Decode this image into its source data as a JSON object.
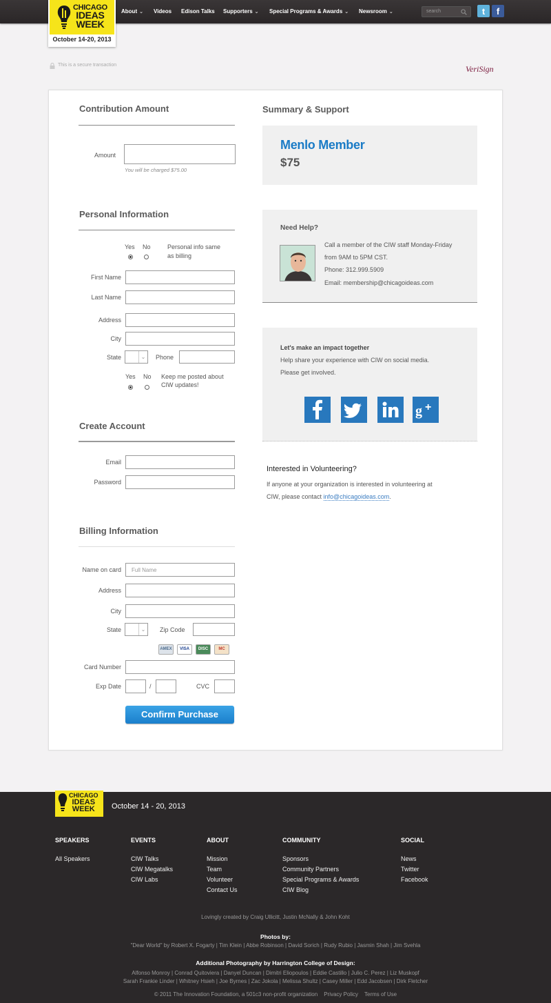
{
  "header": {
    "logo": {
      "line1": "CHICAGO",
      "line2": "IDEAS",
      "line3": "WEEK",
      "date": "October 14-20, 2013"
    },
    "nav": [
      {
        "label": "About",
        "dropdown": true
      },
      {
        "label": "Videos",
        "dropdown": false
      },
      {
        "label": "Edison Talks",
        "dropdown": false
      },
      {
        "label": "Supporters",
        "dropdown": true
      },
      {
        "label": "Special Programs & Awards",
        "dropdown": true
      },
      {
        "label": "Newsroom",
        "dropdown": true
      }
    ],
    "search_placeholder": "search",
    "social": {
      "twitter": "t",
      "facebook": "f"
    }
  },
  "secure": {
    "text": "This is a secure transaction",
    "verisign": "VeriSign"
  },
  "form": {
    "contribution": {
      "title": "Contribution Amount",
      "amount_label": "Amount",
      "amount_value": "",
      "hint": "You will be charged $75.00"
    },
    "personal": {
      "title": "Personal Information",
      "same_yes": "Yes",
      "same_no": "No",
      "same_text_1": "Personal info same",
      "same_text_2": "as billing",
      "first_name": "First Name",
      "last_name": "Last Name",
      "address": "Address",
      "city": "City",
      "state": "State",
      "phone": "Phone",
      "post_yes": "Yes",
      "post_no": "No",
      "post_text_1": "Keep me posted about",
      "post_text_2": "CIW updates!"
    },
    "account": {
      "title": "Create Account",
      "email": "Email",
      "password": "Password"
    },
    "billing": {
      "title": "Billing Information",
      "name_on_card": "Name on card",
      "name_placeholder": "Full Name",
      "address": "Address",
      "city": "City",
      "state": "State",
      "zip": "Zip Code",
      "cards": [
        "AMEX",
        "VISA",
        "DISC",
        "MC"
      ],
      "card_number": "Card Number",
      "exp_date": "Exp Date",
      "exp_sep": "/",
      "cvc": "CVC"
    },
    "confirm_button": "Confirm Purchase"
  },
  "summary": {
    "title": "Summary & Support",
    "tier": "Menlo Member",
    "price": "$75",
    "help": {
      "title": "Need Help?",
      "line1": "Call a member of the CIW staff Monday-Friday",
      "line2": "from 9AM to 5PM CST.",
      "phone": "Phone: 312.999.5909",
      "email": "Email: membership@chicagoideas.com"
    },
    "impact": {
      "title": "Let's make an impact together",
      "line1": "Help share your experience with CIW on social media.",
      "line2": "Please get involved."
    },
    "volunteer": {
      "title": "Interested in Volunteering?",
      "line1": "If anyone at your organization is interested in volunteering at",
      "line2_prefix": "CIW, please contact ",
      "email": "info@chicagoideas.com",
      "line2_suffix": "."
    }
  },
  "footer": {
    "logo": {
      "line1": "CHICAGO",
      "line2": "IDEAS",
      "line3": "WEEK"
    },
    "date": "October 14 - 20, 2013",
    "columns": [
      {
        "heading": "SPEAKERS",
        "links": [
          "All Speakers"
        ]
      },
      {
        "heading": "EVENTS",
        "links": [
          "CIW Talks",
          "CIW Megatalks",
          "CIW Labs"
        ]
      },
      {
        "heading": "ABOUT",
        "links": [
          "Mission",
          "Team",
          "Volunteer",
          "Contact Us"
        ]
      },
      {
        "heading": "COMMUNITY",
        "links": [
          "Sponsors",
          "Community Partners",
          "Special Programs & Awards",
          "CIW Blog"
        ]
      },
      {
        "heading": "SOCIAL",
        "links": [
          "News",
          "Twitter",
          "Facebook"
        ]
      }
    ],
    "credits": "Lovingly created by Craig Ullicitt, Justin McNally & John Koht",
    "photos_title": "Photos by:",
    "photos_line": "\"Dear World\" by Robert X. Fogarty | Tim Klein | Abbe Robinson | David Sorich | Rudy Rubio | Jasmin Shah | Jim Svehla",
    "additional_title": "Additional Photography by Harrington College of Design:",
    "additional_line1": "Alfonso Monroy | Conrad Quitoviera | Danyel Duncan | Dimitri Eliopoulos | Eddie Castillo | Julio C. Perez | Liz Muskopf",
    "additional_line2": "Sarah Frankie Linder | Whitney Hsieh | Joe Byrnes | Zac Jokola | Melissa Shultz | Casey Miller | Edd Jacobsen | Dirk Fletcher",
    "copyright": "© 2011 The Innovation Foundation, a 501c3 non-profit organization",
    "privacy": "Privacy Policy",
    "terms": "Terms of Use"
  }
}
